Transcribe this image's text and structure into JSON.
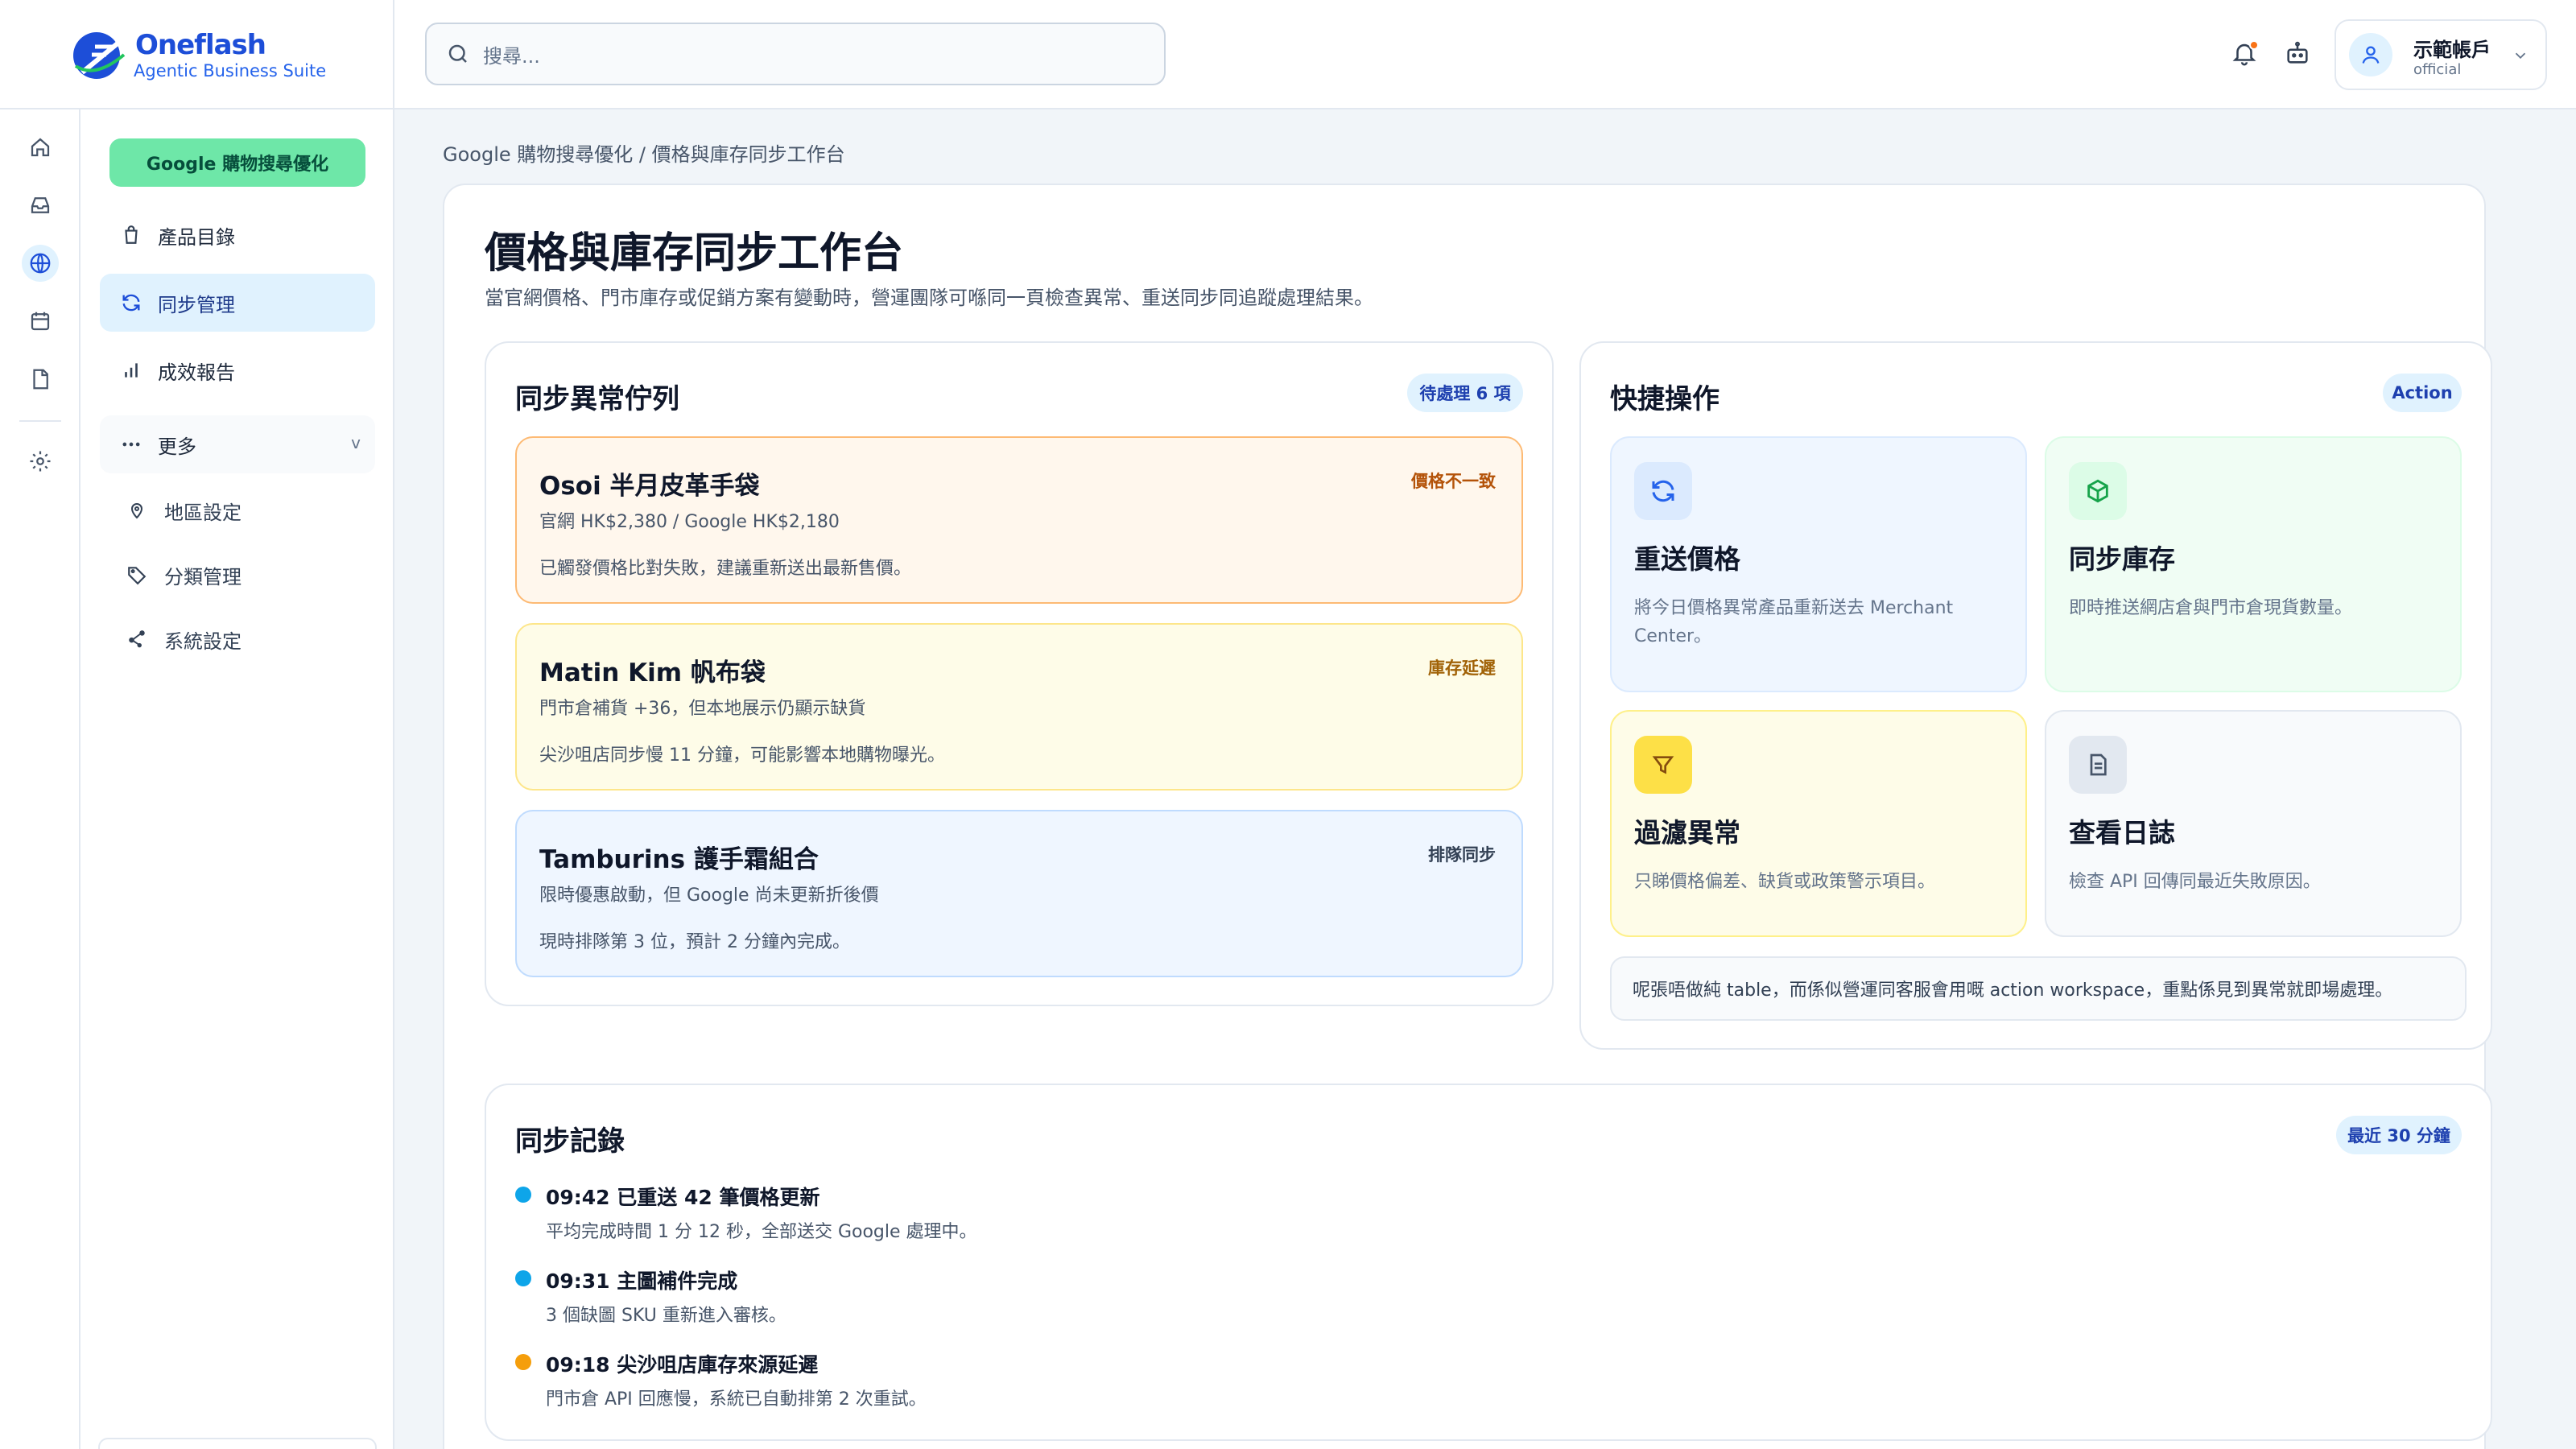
{
  "brand": {
    "name": "Oneflash",
    "tagline": "Agentic Business Suite"
  },
  "search": {
    "placeholder": "搜尋..."
  },
  "account": {
    "name": "示範帳戶",
    "role": "official"
  },
  "sidebar": {
    "section_pill": "Google 購物搜尋優化",
    "items": [
      {
        "label": "產品目錄",
        "icon": "bag-icon"
      },
      {
        "label": "同步管理",
        "icon": "sync-icon",
        "active": true
      },
      {
        "label": "成效報告",
        "icon": "bar-chart-icon"
      },
      {
        "label": "更多",
        "icon": "more-icon",
        "chevron": "v"
      }
    ],
    "sub_items": [
      {
        "label": "地區設定",
        "icon": "map-pin-icon"
      },
      {
        "label": "分類管理",
        "icon": "tag-icon"
      },
      {
        "label": "系統設定",
        "icon": "settings-nodes-icon"
      }
    ]
  },
  "rail": [
    "home-icon",
    "inbox-icon",
    "globe-icon",
    "calendar-icon",
    "file-icon",
    "settings-icon"
  ],
  "breadcrumb": "Google 購物搜尋優化 / 價格與庫存同步工作台",
  "page": {
    "title": "價格與庫存同步工作台",
    "description": "當官網價格、門市庫存或促銷方案有變動時，營運團隊可喺同一頁檢查異常、重送同步同追蹤處理結果。"
  },
  "queue": {
    "title": "同步異常佇列",
    "badge": "待處理 6 項",
    "items": [
      {
        "title": "Osoi 半月皮革手袋",
        "tag": "價格不一致",
        "line1": "官網 HK$2,380 / Google HK$2,180",
        "line2": "已觸發價格比對失敗，建議重新送出最新售價。",
        "bg": "#fff7ed",
        "border": "#fdba74",
        "tag_color": "#b45309"
      },
      {
        "title": "Matin Kim 帆布袋",
        "tag": "庫存延遲",
        "line1": "門市倉補貨 +36，但本地展示仍顯示缺貨",
        "line2": "尖沙咀店同步慢 11 分鐘，可能影響本地購物曝光。",
        "bg": "#fefce8",
        "border": "#fde68a",
        "tag_color": "#a16207"
      },
      {
        "title": "Tamburins 護手霜組合",
        "tag": "排隊同步",
        "line1": "限時優惠啟動，但 Google 尚未更新折後價",
        "line2": "現時排隊第 3 位，預計 2 分鐘內完成。",
        "bg": "#eff6ff",
        "border": "#bfdbfe",
        "tag_color": "#334155"
      }
    ]
  },
  "quick": {
    "title": "快捷操作",
    "badge": "Action",
    "tiles": [
      {
        "title": "重送價格",
        "desc": "將今日價格異常產品重新送去 Merchant Center。",
        "icon": "refresh-icon",
        "bg": "#eff6ff",
        "border": "#dbeafe",
        "icon_bg": "#dbeafe",
        "icon_color": "#2563eb"
      },
      {
        "title": "同步庫存",
        "desc": "即時推送網店倉與門市倉現貨數量。",
        "icon": "box-icon",
        "bg": "#f0fdf4",
        "border": "#dcfce7",
        "icon_bg": "#dcfce7",
        "icon_color": "#16a34a"
      },
      {
        "title": "過濾異常",
        "desc": "只睇價格偏差、缺貨或政策警示項目。",
        "icon": "filter-icon",
        "bg": "#fefce8",
        "border": "#fef08a",
        "icon_bg": "#fde047",
        "icon_color": "#854d0e"
      },
      {
        "title": "查看日誌",
        "desc": "檢查 API 回傳同最近失敗原因。",
        "icon": "document-icon",
        "bg": "#f8fafc",
        "border": "#e2e8f0",
        "icon_bg": "#e2e8f0",
        "icon_color": "#475569"
      }
    ],
    "note": "呢張唔做純 table，而係似營運同客服會用嘅 action workspace，重點係見到異常就即場處理。"
  },
  "log": {
    "title": "同步記錄",
    "badge": "最近 30 分鐘",
    "entries": [
      {
        "title": "09:42 已重送 42 筆價格更新",
        "sub": "平均完成時間 1 分 12 秒，全部送交 Google 處理中。",
        "color": "#0ea5e9"
      },
      {
        "title": "09:31 主圖補件完成",
        "sub": "3 個缺圖 SKU 重新進入審核。",
        "color": "#0ea5e9"
      },
      {
        "title": "09:18 尖沙咀店庫存來源延遲",
        "sub": "門市倉 API 回應慢，系統已自動排第 2 次重試。",
        "color": "#f59e0b"
      }
    ]
  }
}
